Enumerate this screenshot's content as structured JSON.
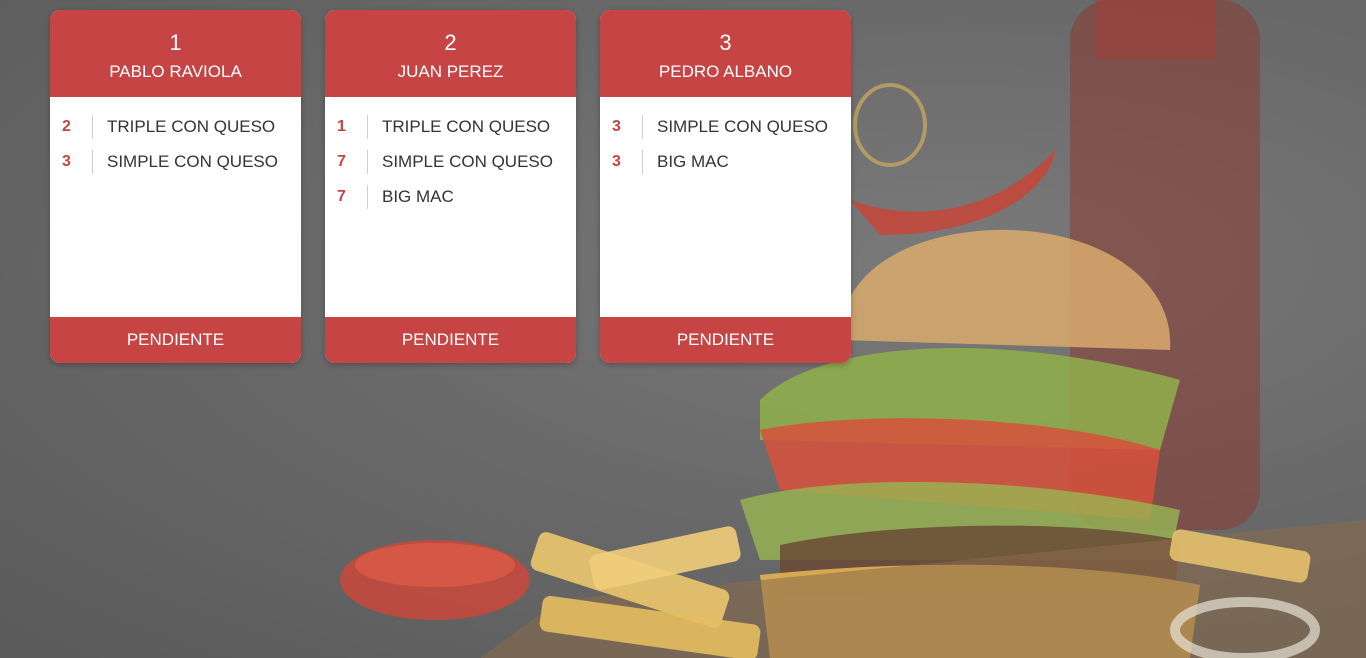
{
  "orders": [
    {
      "number": "1",
      "customer": "PABLO RAVIOLA",
      "items": [
        {
          "qty": "2",
          "name": "TRIPLE CON QUESO"
        },
        {
          "qty": "3",
          "name": "SIMPLE CON QUESO"
        }
      ],
      "status": "PENDIENTE"
    },
    {
      "number": "2",
      "customer": "JUAN PEREZ",
      "items": [
        {
          "qty": "1",
          "name": "TRIPLE CON QUESO"
        },
        {
          "qty": "7",
          "name": "SIMPLE CON QUESO"
        },
        {
          "qty": "7",
          "name": "BIG MAC"
        }
      ],
      "status": "PENDIENTE"
    },
    {
      "number": "3",
      "customer": "PEDRO ALBANO",
      "items": [
        {
          "qty": "3",
          "name": "SIMPLE CON QUESO"
        },
        {
          "qty": "3",
          "name": "BIG MAC"
        }
      ],
      "status": "PENDIENTE"
    }
  ],
  "colors": {
    "accent": "#c64444",
    "card_bg": "#ffffff",
    "text": "#333333"
  }
}
